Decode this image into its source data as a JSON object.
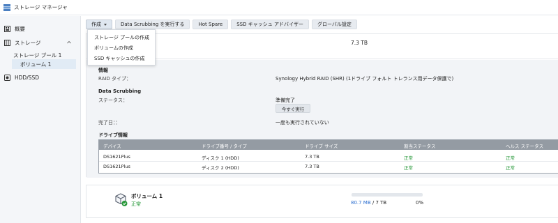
{
  "app": {
    "title": "ストレージ マネージャ"
  },
  "sidebar": {
    "items": [
      {
        "label": "概要",
        "icon": "overview-icon"
      },
      {
        "label": "ストレージ",
        "icon": "storage-icon"
      },
      {
        "label": "ストレージ プール 1"
      },
      {
        "label": "ボリューム 1"
      },
      {
        "label": "HDD/SSD",
        "icon": "disk-icon"
      }
    ]
  },
  "toolbar": {
    "create_label": "作成",
    "scrub_label": "Data Scrubbing を実行する",
    "hotspare_label": "Hot Spare",
    "ssd_advisor_label": "SSD キャッシュ アドバイザー",
    "global_label": "グローバル設定"
  },
  "dropdown": {
    "items": [
      "ストレージ プールの作成",
      "ボリュームの作成",
      "SSD キャッシュの作成"
    ]
  },
  "summary": {
    "capacity": "7.3 TB"
  },
  "info": {
    "title": "情報",
    "raid_label": "RAID タイプ：",
    "raid_value": "Synology Hybrid RAID (SHR) (1ドライブ フォルト トレランス用データ保護で)"
  },
  "scrubbing": {
    "title": "Data Scrubbing",
    "status_label": "ステータス：",
    "status_value": "準備完了",
    "run_now": "今すぐ実行",
    "completed_label": "完了日：：",
    "completed_value": "一度も実行されていない"
  },
  "drives": {
    "title": "ドライブ情報",
    "headers": [
      "デバイス",
      "ドライブ番号 / タイプ",
      "ドライブ サイズ",
      "割当ステータス",
      "ヘルス ステータス"
    ],
    "rows": [
      {
        "device": "DS1621Plus",
        "number": "ディスク 1 (HDD)",
        "size": "7.3 TB",
        "alloc": "正常",
        "health": "正常"
      },
      {
        "device": "DS1621Plus",
        "number": "ディスク 2 (HDD)",
        "size": "7.3 TB",
        "alloc": "正常",
        "health": "正常"
      }
    ]
  },
  "volume": {
    "name": "ボリューム 1",
    "status": "正常",
    "used": "80.7 MB",
    "separator": " / ",
    "total": "7 TB",
    "percent": "0%",
    "usage_fraction": 0.0
  },
  "colors": {
    "ok": "#2a9a3c",
    "accent": "#3b7bd4",
    "table_header": "#949ba3"
  }
}
